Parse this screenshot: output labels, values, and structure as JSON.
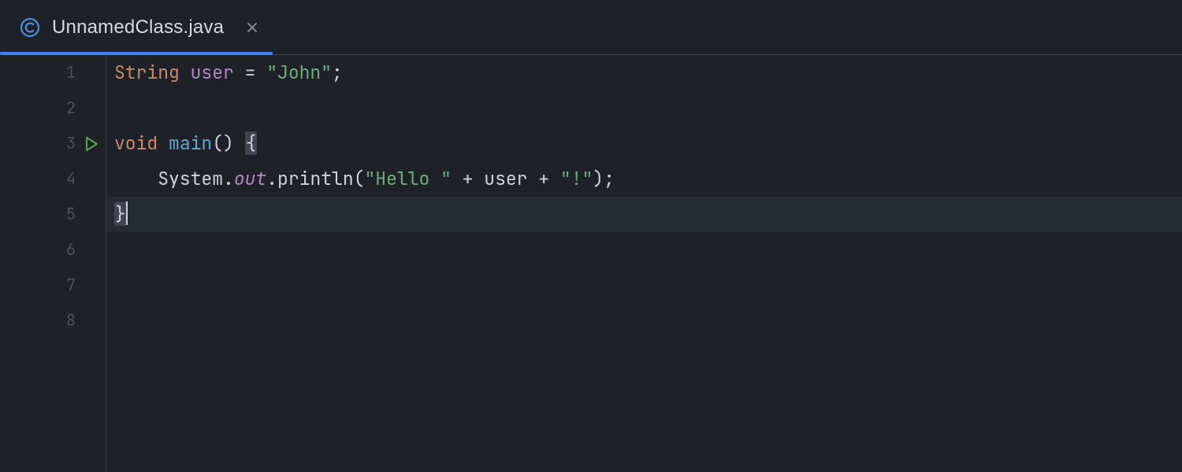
{
  "tab": {
    "title": "UnnamedClass.java",
    "icon": "class-icon"
  },
  "gutter": {
    "lines": [
      "1",
      "2",
      "3",
      "4",
      "5",
      "6",
      "7",
      "8"
    ],
    "run_line": 3
  },
  "code": {
    "current_line": 5,
    "line1": {
      "type_kw": "String",
      "var": "user",
      "eq": " = ",
      "str": "\"John\"",
      "semi": ";"
    },
    "line3": {
      "kw": "void",
      "fn": "main",
      "parens": "()",
      "space": " ",
      "brace": "{"
    },
    "line4": {
      "indent": "    ",
      "sys": "System",
      "dot1": ".",
      "out": "out",
      "dot2": ".",
      "println": "println",
      "open": "(",
      "s1": "\"Hello \"",
      "plus1": " + ",
      "var": "user",
      "plus2": " + ",
      "s2": "\"!\"",
      "close": ")",
      "semi": ";"
    },
    "line5": {
      "brace": "}"
    }
  }
}
